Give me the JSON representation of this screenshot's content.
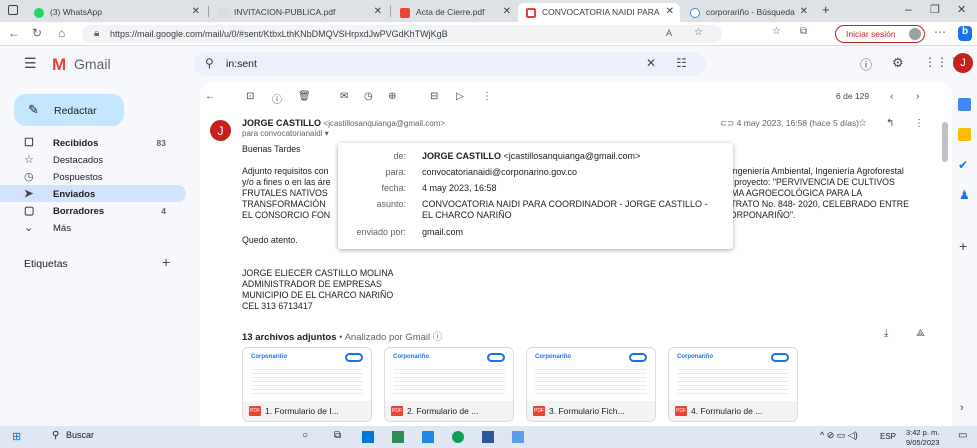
{
  "browser": {
    "tabs": [
      {
        "label": "(3) WhatsApp",
        "color": "#25d366"
      },
      {
        "label": "INVITACION-PUBLICA.pdf",
        "color": "#9aa0a6"
      },
      {
        "label": "Acta de Cierre.pdf",
        "color": "#ea4335"
      },
      {
        "label": "CONVOCATORIA NAIDI PARA",
        "color": "#ea4335"
      },
      {
        "label": "corporariño - Búsqueda",
        "color": "#4285f4"
      }
    ],
    "url": "https://mail.google.com/mail/u/0/#sent/KtbxLthKNbDMQVSHrpxdJwPVGdKhTWjKgB",
    "signin": "Iniciar sesión"
  },
  "gmail": {
    "logo": "Gmail",
    "search_value": "in:sent",
    "compose": "Redactar",
    "nav": [
      {
        "label": "Recibidos",
        "count": "83",
        "icon": "inbox-icon",
        "glyph": "☐"
      },
      {
        "label": "Destacados",
        "count": "",
        "icon": "star-icon",
        "glyph": "☆"
      },
      {
        "label": "Pospuestos",
        "count": "",
        "icon": "clock-icon",
        "glyph": "◷"
      },
      {
        "label": "Enviados",
        "count": "",
        "icon": "send-icon",
        "glyph": "➤"
      },
      {
        "label": "Borradores",
        "count": "4",
        "icon": "draft-icon",
        "glyph": "▢"
      },
      {
        "label": "Más",
        "count": "",
        "icon": "chevron-down-icon",
        "glyph": "⌄"
      }
    ],
    "labels_title": "Etiquetas",
    "pager": "6 de 129"
  },
  "email": {
    "sender_name": "JORGE CASTILLO",
    "sender_email": "<jcastillosanquianga@gmail.com>",
    "to": "para convocatorianaidi",
    "date": "4 may 2023, 16:58 (hace 5 días)",
    "greeting": "Buenas Tardes",
    "para1": [
      "Adjunto requisitos con",
      "y/o a fines o en las áre",
      "FRUTALES NATIVOS",
      "TRANSFORMACIÓN",
      "EL CONSORCIO FON"
    ],
    "para1_right": [
      "área de Ingeniería Ambiental, Ingeniería Agroforestal",
      "neral del proyecto: \"PERVIVENCIA DE CULTIVOS",
      "DE FORMA AGROECOLÓGICA PARA LA",
      "EL CONTRATO No. 848- 2020, CELEBRADO ENTRE",
      "IÑO – CORPONARIÑO\"."
    ],
    "closing": "Quedo atento.",
    "signature": [
      "JORGE ELIECER CASTILLO MOLINA",
      "ADMINISTRADOR DE EMPRESAS",
      "MUNICIPIO DE EL CHARCO NARIÑO",
      "CEL 313 6713417"
    ],
    "attachments_title": "13 archivos adjuntos",
    "attachments_scan": " • Analizado por Gmail ⓘ",
    "attachments": [
      "1. Formulario de I...",
      "2. Formulario de ...",
      "3. Formulario Fich...",
      "4. Formulario de ..."
    ],
    "attachment_logo": "Corponariño"
  },
  "popup": {
    "de_label": "de:",
    "de_name": "JORGE CASTILLO",
    "de_email": "<jcastillosanquianga@gmail.com>",
    "para_label": "para:",
    "para_value": "convocatorianaidi@corponarino.gov.co",
    "fecha_label": "fecha:",
    "fecha_value": "4 may 2023, 16:58",
    "asunto_label": "asunto:",
    "asunto_value": "CONVOCATORIA NAIDI PARA COORDINADOR - JORGE CASTILLO - EL CHARCO NARIÑO",
    "enviado_label": "enviado por:",
    "enviado_value": "gmail.com"
  },
  "taskbar": {
    "search": "Buscar",
    "lang": "ESP",
    "time": "3:42 p. m.",
    "date": "9/05/2023"
  }
}
